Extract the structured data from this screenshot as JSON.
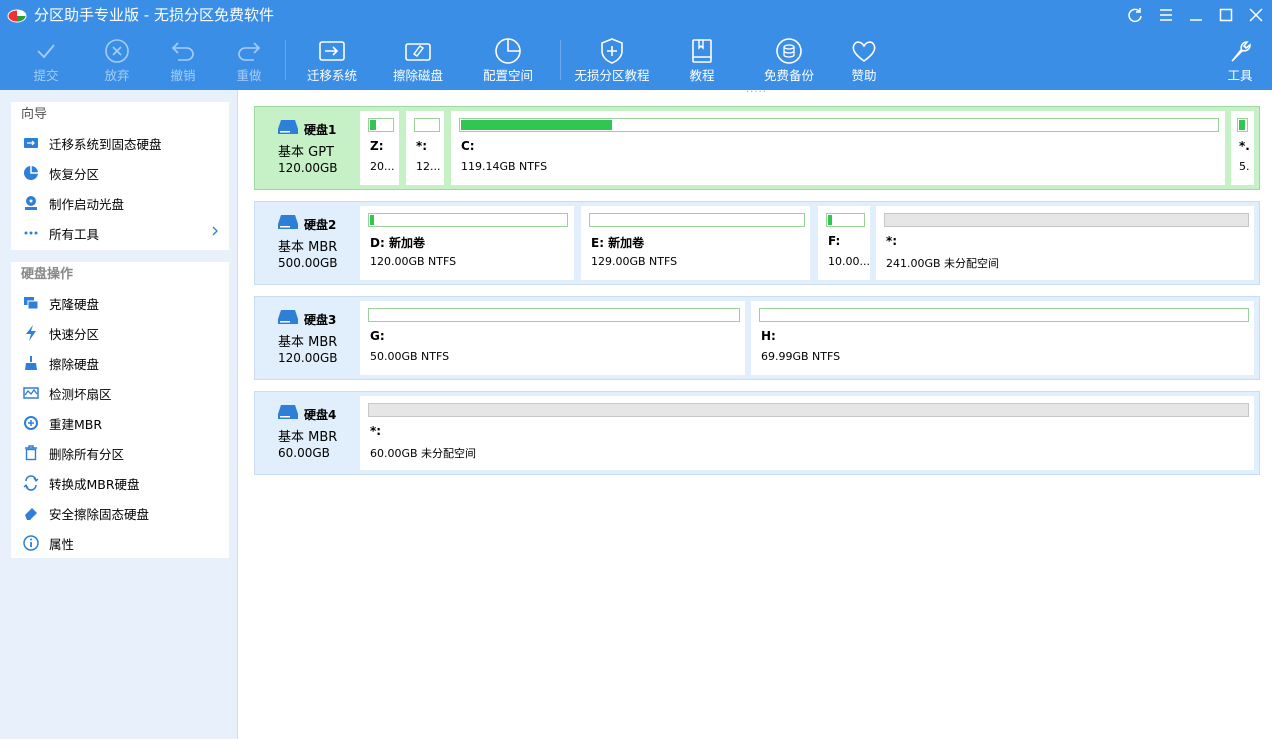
{
  "app": {
    "title": "分区助手专业版 - 无损分区免费软件"
  },
  "toolbar": {
    "commit": "提交",
    "discard": "放弃",
    "undo": "撤销",
    "redo": "重做",
    "migrate": "迁移系统",
    "wipe": "擦除磁盘",
    "alloc": "配置空间",
    "tutorial_lossless": "无损分区教程",
    "tutorial": "教程",
    "backup": "免费备份",
    "donate": "赞助",
    "tools": "工具"
  },
  "sidebar": {
    "wizard_title": "向导",
    "wizard_items": [
      "迁移系统到固态硬盘",
      "恢复分区",
      "制作启动光盘",
      "所有工具"
    ],
    "ops_title": "硬盘操作",
    "ops_items": [
      "克隆硬盘",
      "快速分区",
      "擦除硬盘",
      "检测坏扇区",
      "重建MBR",
      "删除所有分区",
      "转换成MBR硬盘",
      "安全擦除固态硬盘",
      "属性"
    ]
  },
  "disks": [
    {
      "name": "硬盘1",
      "type": "基本 GPT",
      "size": "120.00GB",
      "partitions": [
        {
          "label": "Z:",
          "info": "20...",
          "used": 0.25
        },
        {
          "label": "*:",
          "info": "12...",
          "used": 0
        },
        {
          "label": "C:",
          "info": "119.14GB NTFS",
          "used": 0.2
        },
        {
          "label": "*.",
          "info": "5.",
          "used": 0.8
        }
      ]
    },
    {
      "name": "硬盘2",
      "type": "基本 MBR",
      "size": "500.00GB",
      "partitions": [
        {
          "label": "D: 新加卷",
          "info": "120.00GB NTFS",
          "used": 0.02
        },
        {
          "label": "E: 新加卷",
          "info": "129.00GB NTFS",
          "used": 0
        },
        {
          "label": "F:",
          "info": "10.00...",
          "used": 0.1
        },
        {
          "label": "*:",
          "info": "241.00GB 未分配空间",
          "used": 0
        }
      ]
    },
    {
      "name": "硬盘3",
      "type": "基本 MBR",
      "size": "120.00GB",
      "partitions": [
        {
          "label": "G:",
          "info": "50.00GB NTFS",
          "used": 0
        },
        {
          "label": "H:",
          "info": "69.99GB NTFS",
          "used": 0
        }
      ]
    },
    {
      "name": "硬盘4",
      "type": "基本 MBR",
      "size": "60.00GB",
      "partitions": [
        {
          "label": "*:",
          "info": "60.00GB 未分配空间",
          "used": 0
        }
      ]
    }
  ],
  "colors": {
    "accent": "#3a8ee6",
    "used_fill": "#2fc652",
    "selected_row": "#c6f0c6"
  }
}
